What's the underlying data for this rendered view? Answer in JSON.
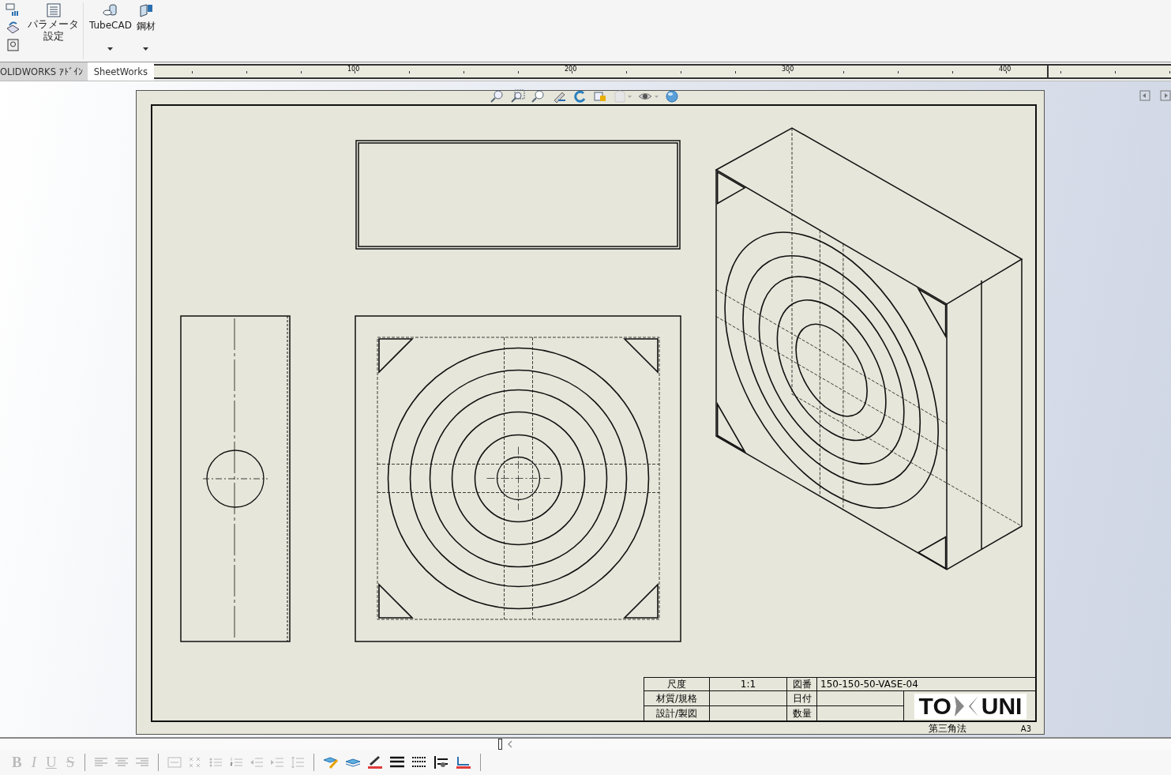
{
  "ribbon": {
    "parameter_button": {
      "lines": [
        "パラメータ",
        "設定"
      ]
    },
    "tools": [
      {
        "label": "TubeCAD",
        "dropdown": true
      },
      {
        "label": "鋼材",
        "dropdown": true
      }
    ]
  },
  "tabs": [
    {
      "label": "OLIDWORKS ｱﾄﾞｲﾝ",
      "selected": false
    },
    {
      "label": "SheetWorks",
      "selected": true
    }
  ],
  "ruler": {
    "labels": [
      "100",
      "200",
      "300",
      "400"
    ]
  },
  "title_block": {
    "left_fields": [
      {
        "label": "尺度",
        "value": "1:1"
      },
      {
        "label": "材質/規格"
      },
      {
        "label": "設計/製図"
      }
    ],
    "mid_fields": [
      {
        "label": "図番",
        "value": "150-150-50-VASE-04"
      },
      {
        "label": "日付"
      },
      {
        "label": "数量"
      }
    ],
    "logo": {
      "left": "TO",
      "right": "UNI"
    },
    "projection": "第三角法",
    "sheet_size": "A3"
  },
  "format_toolbar": {
    "text_style_buttons": [
      {
        "label": "B",
        "kind": "bold",
        "disabled": true
      },
      {
        "label": "I",
        "kind": "italic",
        "disabled": true
      },
      {
        "label": "U",
        "kind": "underline",
        "disabled": true
      },
      {
        "label": "S",
        "kind": "strike",
        "disabled": true
      }
    ]
  }
}
